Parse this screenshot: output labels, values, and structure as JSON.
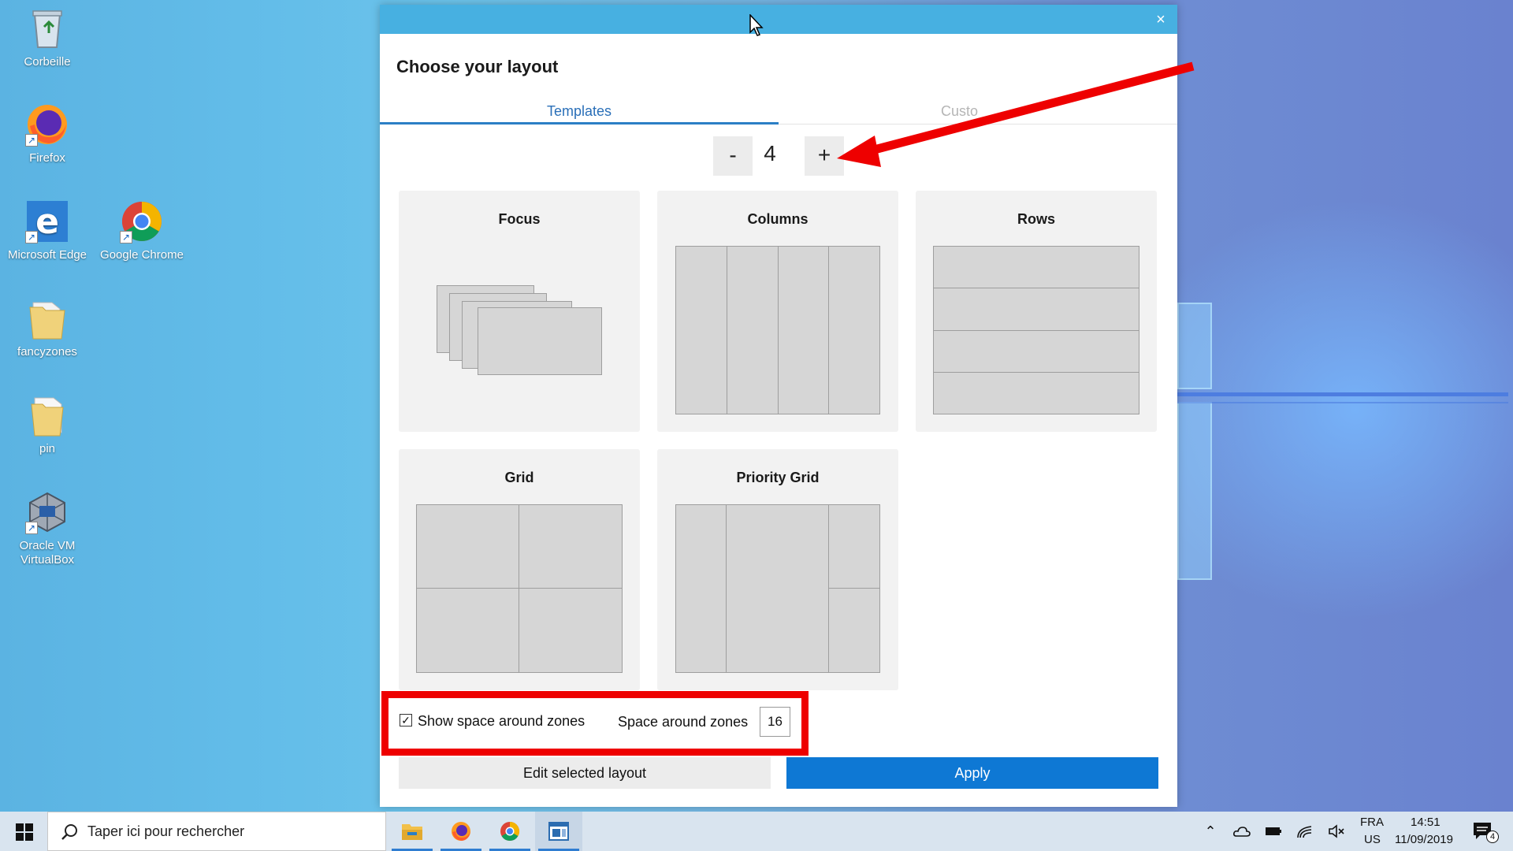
{
  "desktop": {
    "icons": [
      {
        "label": "Corbeille",
        "icon": "recycle-bin-icon"
      },
      {
        "label": "Firefox",
        "icon": "firefox-icon"
      },
      {
        "label": "Microsoft Edge",
        "icon": "edge-icon"
      },
      {
        "label": "Google Chrome",
        "icon": "chrome-icon"
      },
      {
        "label": "fancyzones",
        "icon": "folder-icon"
      },
      {
        "label": "pin",
        "icon": "folder-icon"
      },
      {
        "label": "Oracle VM VirtualBox",
        "icon": "virtualbox-icon"
      }
    ]
  },
  "dialog": {
    "title": "Choose your layout",
    "close_symbol": "×",
    "tabs": [
      {
        "label": "Templates",
        "active": true
      },
      {
        "label": "Custom",
        "visible_text": "Custo"
      }
    ],
    "stepper": {
      "minus": "-",
      "value": "4",
      "plus": "+"
    },
    "templates": [
      {
        "name": "Focus"
      },
      {
        "name": "Columns"
      },
      {
        "name": "Rows"
      },
      {
        "name": "Grid"
      },
      {
        "name": "Priority Grid"
      }
    ],
    "show_space_label": "Show space around zones",
    "show_space_checked": true,
    "check_symbol": "✓",
    "space_label": "Space around zones",
    "space_value": "16",
    "edit_button": "Edit selected layout",
    "apply_button": "Apply"
  },
  "taskbar": {
    "search_placeholder": "Taper ici pour rechercher",
    "apps": [
      "file-explorer-icon",
      "firefox-icon",
      "chrome-icon",
      "fancyzones-editor-icon"
    ],
    "tray": {
      "lang_top": "FRA",
      "lang_bottom": "US",
      "time": "14:51",
      "date": "11/09/2019",
      "notification_count": "4"
    }
  },
  "colors": {
    "titlebar": "#47b0e1",
    "apply": "#0e78d4",
    "highlight": "#ee0000",
    "tab_accent": "#2b7fc5"
  }
}
